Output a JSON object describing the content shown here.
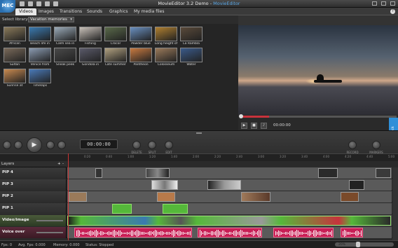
{
  "app": {
    "title": "MovieEditor 3.2 Demo",
    "title_separator": " - ",
    "edition": "MovieEditor",
    "logo_text": "MEC"
  },
  "tabs": [
    {
      "label": "Videos",
      "active": true
    },
    {
      "label": "Images"
    },
    {
      "label": "Transitions"
    },
    {
      "label": "Sounds"
    },
    {
      "label": "Graphics"
    },
    {
      "label": "My media files"
    }
  ],
  "help": "?",
  "library": {
    "label": "Select library:",
    "selected": "Vacation memories"
  },
  "thumbs": [
    {
      "caption": "African",
      "color": "#8a7a5a"
    },
    {
      "caption": "Beach life in",
      "color": "#3a7ab0"
    },
    {
      "caption": "Calm sea in",
      "color": "#9aaab8"
    },
    {
      "caption": "Fishing",
      "color": "#c8c0b8"
    },
    {
      "caption": "Crocor",
      "color": "#5a6a4a"
    },
    {
      "caption": "Powder blue",
      "color": "#6a90c0"
    },
    {
      "caption": "Long height of",
      "color": "#b08030"
    },
    {
      "caption": "La Rambla",
      "color": "#5a4a3a"
    },
    {
      "caption": "Sultan",
      "color": "#7a6a5a"
    },
    {
      "caption": "Venice from",
      "color": "#8a9ab0"
    },
    {
      "caption": "Sneak peek",
      "color": "#4a4a4a"
    },
    {
      "caption": "Gondola in",
      "color": "#5a5a6a"
    },
    {
      "caption": "Late summer",
      "color": "#b0a080"
    },
    {
      "caption": "Pantheon",
      "color": "#c87a40"
    },
    {
      "caption": "Colosseum",
      "color": "#9a7a5a"
    },
    {
      "caption": "Water",
      "color": "#3a5a8a"
    },
    {
      "caption": "Sunrise at",
      "color": "#c88a50"
    },
    {
      "caption": "Timelaps",
      "color": "#4a7ab8"
    }
  ],
  "preview": {
    "timecode": "00:00:00"
  },
  "feedback": "Feedback",
  "toolbar": {
    "timecode": "00:00:00",
    "labels": [
      "DELETE",
      "SPLIT",
      "EDIT",
      "RECORD",
      "MARKERS"
    ]
  },
  "ruler": [
    "0:20",
    "0:40",
    "1:00",
    "1:20",
    "1:40",
    "2:00",
    "2:20",
    "2:40",
    "3:00",
    "3:20",
    "3:40",
    "4:00",
    "4:20",
    "4:40",
    "5:00"
  ],
  "layers": {
    "title": "Layers",
    "add": "+",
    "remove": "-"
  },
  "tracks": [
    {
      "name": "PIP 4"
    },
    {
      "name": "PIP 3"
    },
    {
      "name": "PIP 2"
    },
    {
      "name": "PIP 1"
    },
    {
      "name": "Video/image"
    },
    {
      "name": "Voice over"
    }
  ],
  "status": {
    "fps": "Fps: 0",
    "avg_fps": "Avg. Fps: 0.000",
    "memory": "Memory: 0.000",
    "status": "Status: Stopped",
    "zoom": "20%"
  }
}
